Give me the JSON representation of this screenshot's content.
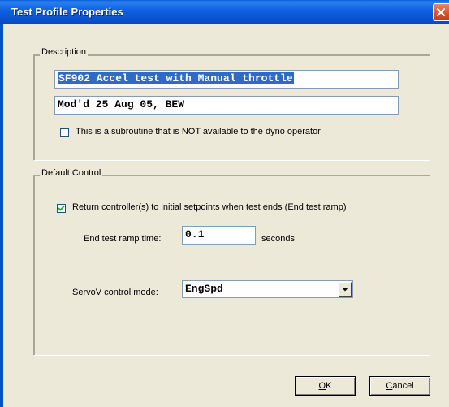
{
  "window": {
    "title": "Test Profile Properties",
    "close_icon": "close-x-icon"
  },
  "description_group": {
    "legend": "Description",
    "name_field": {
      "value_selected": "SF902 Accel test with Manual throttle"
    },
    "notes_field": {
      "value": "Mod'd 25 Aug 05, BEW"
    },
    "subroutine_checkbox": {
      "checked": false,
      "label": "This is a subroutine that is NOT available to the dyno operator"
    }
  },
  "default_control_group": {
    "legend": "Default Control",
    "return_checkbox": {
      "checked": true,
      "label": "Return controller(s) to initial setpoints when test ends (End test ramp)"
    },
    "ramp_time": {
      "label": "End test ramp time:",
      "value": "0.1",
      "units": "seconds"
    },
    "servov_mode": {
      "label": "ServoV control mode:",
      "selected": "EngSpd",
      "arrow_icon": "chevron-down-icon"
    }
  },
  "buttons": {
    "ok": {
      "accel": "O",
      "rest": "K"
    },
    "cancel": {
      "accel": "C",
      "rest": "ancel"
    }
  }
}
